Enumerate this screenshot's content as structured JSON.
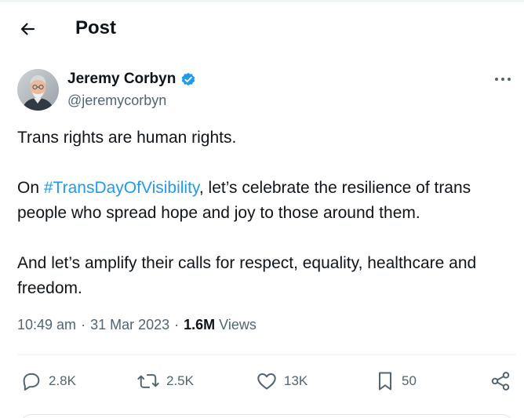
{
  "header": {
    "title": "Post"
  },
  "author": {
    "name": "Jeremy Corbyn",
    "handle": "@jeremycorbyn",
    "verified_color": "#1d9bf0"
  },
  "tweet": {
    "line1": "Trans rights are human rights.",
    "para2_prefix": "On ",
    "hashtag": "#TransDayOfVisibility",
    "para2_suffix": ", let’s celebrate the resilience of trans people who spread hope and joy to those around them.",
    "para3": "And let’s amplify their calls for respect, equality, healthcare and freedom."
  },
  "meta": {
    "time": "10:49 am",
    "separator": "·",
    "date": "31 Mar 2023",
    "views_count": "1.6M",
    "views_label": "Views"
  },
  "actions": {
    "replies": "2.8K",
    "reposts": "2.5K",
    "likes": "13K",
    "bookmarks": "50"
  },
  "icons": {
    "back": "arrow-left-icon",
    "more": "more-horizontal-icon",
    "verified": "verified-badge-icon",
    "reply": "reply-icon",
    "repost": "repost-icon",
    "like": "heart-icon",
    "bookmark": "bookmark-icon",
    "share": "share-icon"
  },
  "colors": {
    "accent": "#1d9bf0",
    "text_primary": "#0f1419",
    "text_secondary": "#536471",
    "divider": "#eff3f4"
  }
}
